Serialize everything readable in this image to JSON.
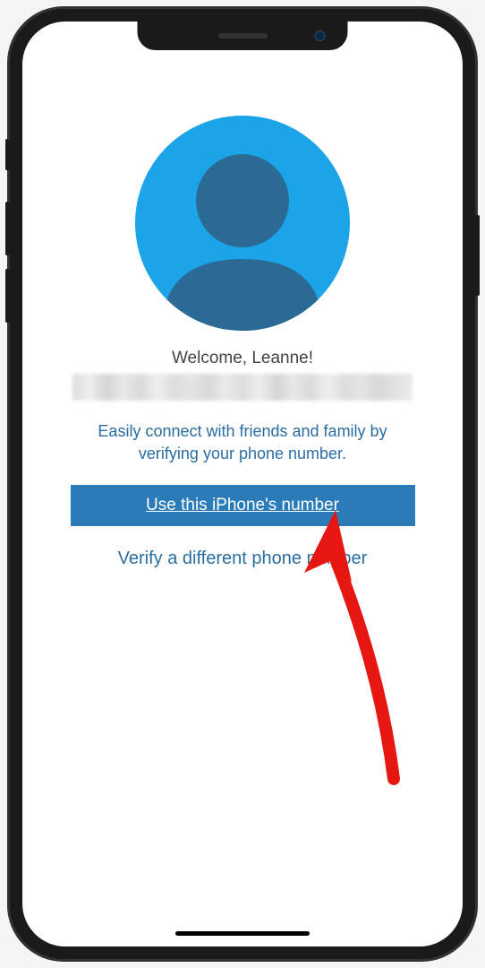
{
  "welcome": {
    "greeting": "Welcome, Leanne!",
    "description": "Easily connect with friends and family by verifying your phone number."
  },
  "buttons": {
    "primary": "Use this iPhone's number",
    "secondary": "Verify a different phone number"
  },
  "colors": {
    "avatar_bg": "#1ba5e8",
    "avatar_fg": "#2a6a94",
    "button_bg": "#2a7bb8",
    "link_color": "#2a6da0",
    "arrow_color": "#e61610"
  },
  "annotation": {
    "arrow_target": "primary-button"
  }
}
